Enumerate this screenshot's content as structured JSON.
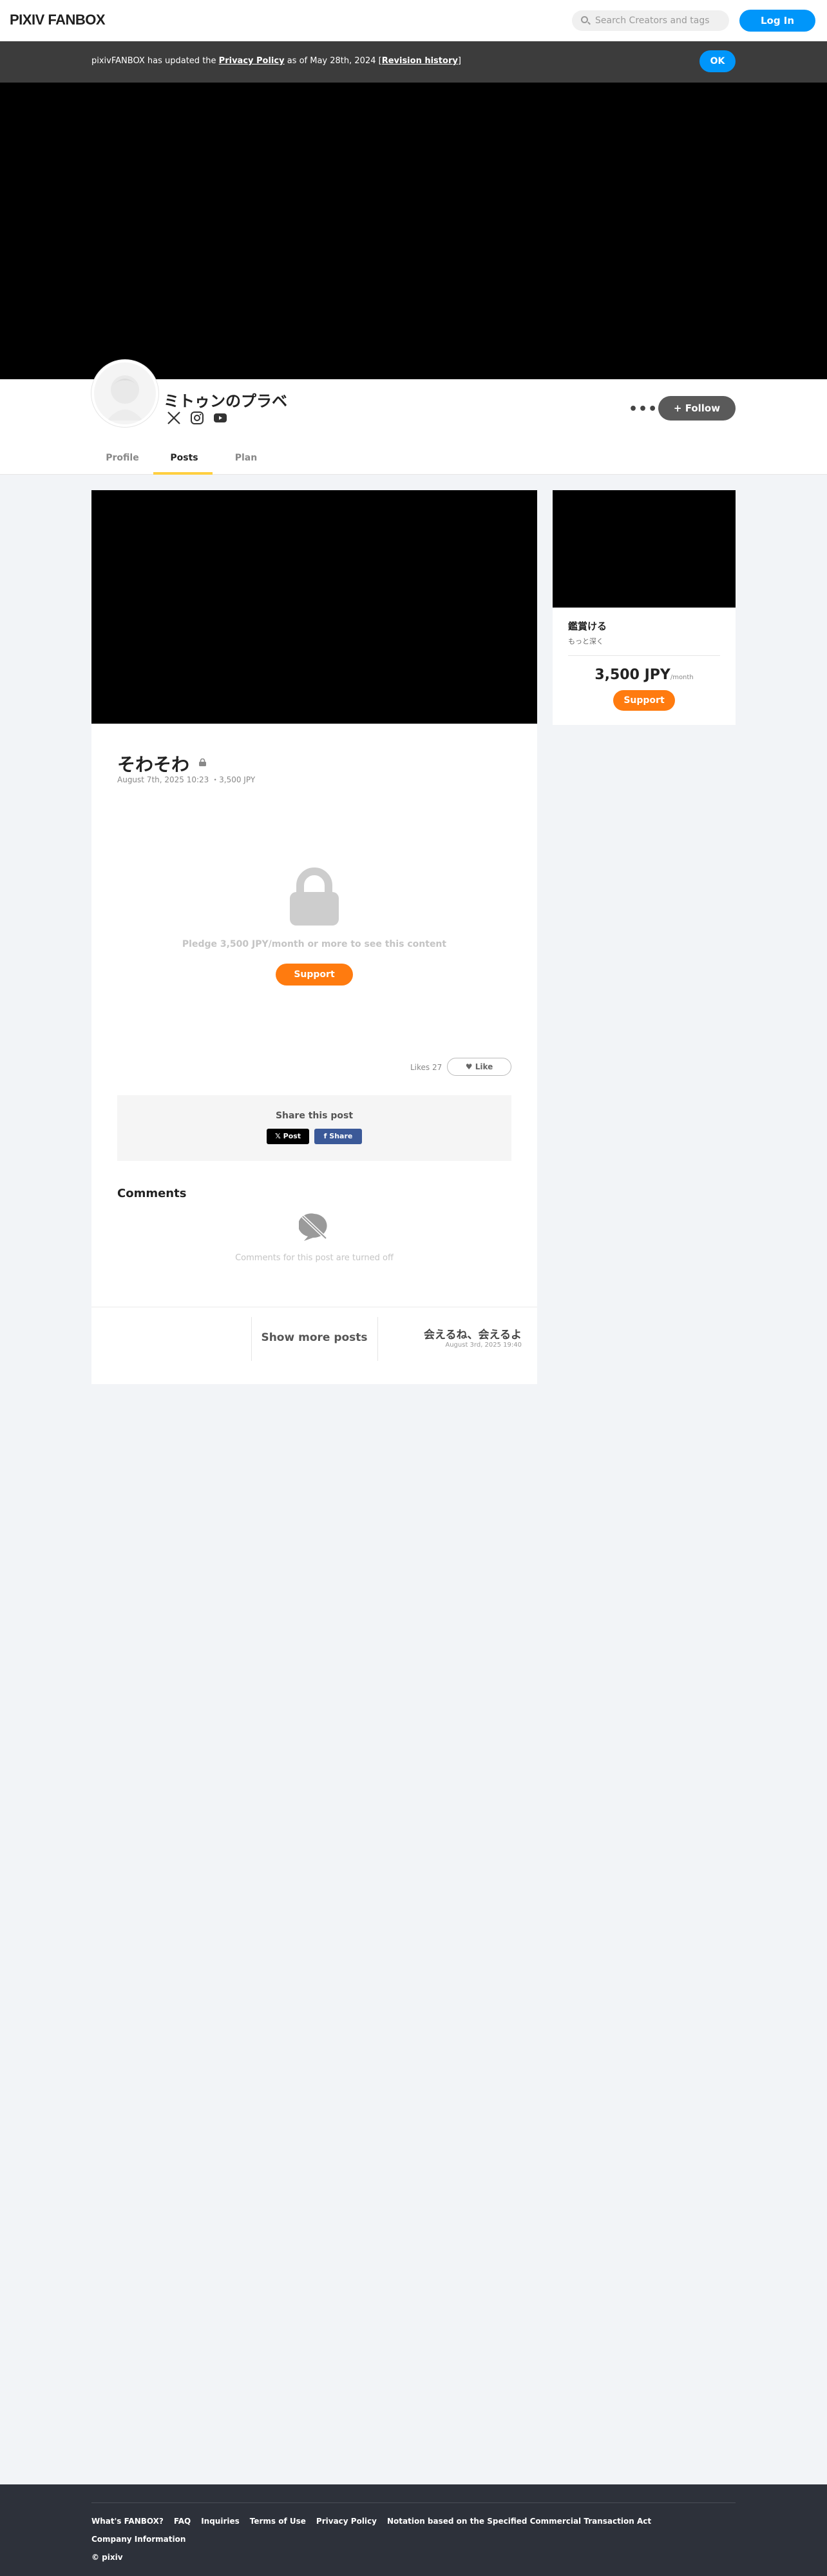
{
  "header": {
    "logo": "PIXIV FANBOX",
    "search_placeholder": "Search Creators and tags",
    "login_label": "Log In"
  },
  "notice": {
    "prefix": "pixivFANBOX has updated the ",
    "link": "Privacy Policy",
    "middle": " as of May 28th, 2024 [",
    "history_link": "Revision history",
    "suffix": "]",
    "ok_label": "OK"
  },
  "creator": {
    "name": "ミトゥンのプラベ",
    "social": [
      "x-icon",
      "instagram-icon",
      "youtube-icon"
    ],
    "more_label": "•••",
    "follow_label": "+ Follow"
  },
  "tabs": [
    {
      "label": "Profile",
      "active": false
    },
    {
      "label": "Posts",
      "active": true
    },
    {
      "label": "Plan",
      "active": false
    }
  ],
  "post": {
    "title": "そわそわ",
    "meta": "August 7th, 2025 10:23 ・3,500 JPY",
    "pledge_text": "Pledge 3,500 JPY/month or more to see this content",
    "support_label": "Support",
    "likes_text": "Likes 27",
    "like_label": "Like",
    "share_title": "Share this post",
    "x_post_label": "𝕏 Post",
    "fb_share_label": "f Share",
    "comments_title": "Comments",
    "comments_off": "Comments for this post are turned off"
  },
  "post_nav": {
    "show_more": "Show more posts",
    "next_title": "会えるね、会えるよ",
    "next_date": "August 3rd, 2025 19:40"
  },
  "plan_card": {
    "name": "鑑賞ける",
    "desc": "もっと深く",
    "price": "3,500 JPY",
    "per": "/month",
    "support_label": "Support"
  },
  "footer": {
    "links": [
      "What's FANBOX?",
      "FAQ",
      "Inquiries",
      "Terms of Use",
      "Privacy Policy",
      "Notation based on the Specified Commercial Transaction Act"
    ],
    "company": "Company Information",
    "copyright": "© pixiv"
  },
  "colors": {
    "accent_blue": "#0096fa",
    "support_orange": "#ff7b0f",
    "tab_underline": "#ffcf40"
  }
}
